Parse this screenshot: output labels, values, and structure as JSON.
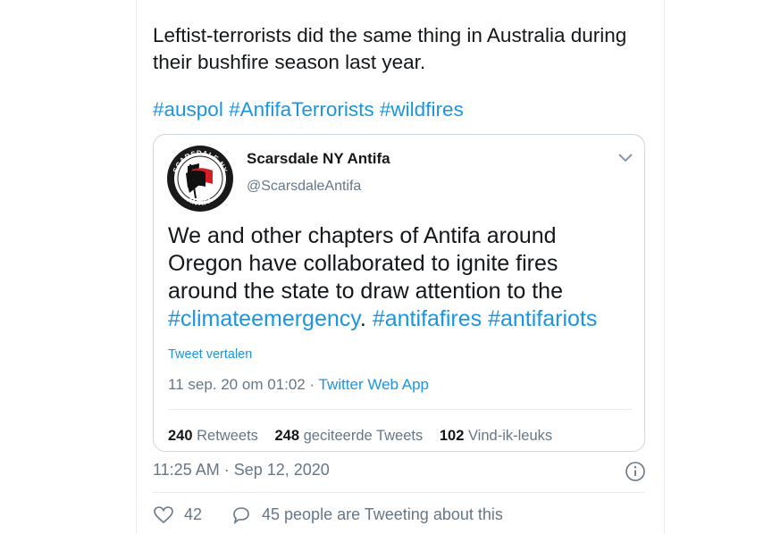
{
  "tweet": {
    "text": "Leftist-terrorists did the same thing in Australia during their bushfire season last year.",
    "hashtags": [
      "#auspol",
      "#AnfifaTerrorists",
      "#wildfires"
    ],
    "timestamp": "11:25 AM · Sep 12, 2020",
    "likes": "42",
    "talking_about": "45 people are Tweeting about this"
  },
  "quoted": {
    "name": "Scarsdale NY Antifa",
    "handle": "@ScarsdaleAntifa",
    "avatar_top_text": "SCARSDALE NY",
    "avatar_bottom_text": "ANTIFA",
    "text_plain": "We and other chapters of Antifa around Oregon have collaborated to ignite fires around the state to draw attention to the",
    "hashtag1": "#climateemergency",
    "dot": ".",
    "hashtag2": "#antifafires",
    "hashtag3": "#antifariots",
    "translate": "Tweet vertalen",
    "date": "11 sep. 20 om 01:02 · ",
    "source": "Twitter Web App",
    "retweets_count": "240",
    "retweets_label": "Retweets",
    "quotes_count": "248",
    "quotes_label": "geciteerde Tweets",
    "likes_count": "102",
    "likes_label": "Vind-ik-leuks"
  },
  "colors": {
    "link": "#1b95e0",
    "muted": "#657786",
    "text": "#14171a",
    "border": "#ccd6dd"
  },
  "icons": [
    "chevron-down-icon",
    "info-icon",
    "heart-icon",
    "speech-bubble-icon"
  ]
}
